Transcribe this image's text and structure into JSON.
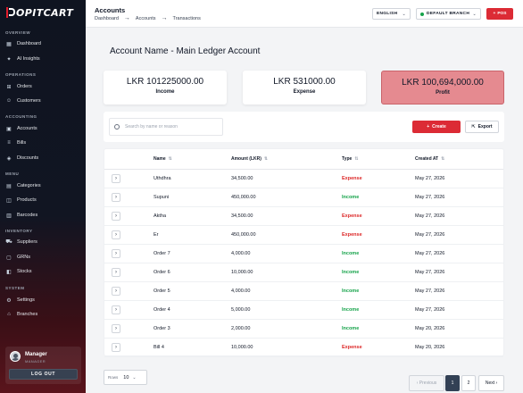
{
  "brand": {
    "logo_text": "OPITCART",
    "accent": "#dc2b35"
  },
  "sidebar": {
    "sections": [
      {
        "label": "OVERVIEW"
      },
      {
        "label": "OPERATIONS"
      },
      {
        "label": "ACCOUNTING"
      },
      {
        "label": "MENU"
      },
      {
        "label": "INVENTORY"
      },
      {
        "label": "SYSTEM"
      }
    ],
    "items": [
      {
        "label": "Dashboard",
        "icon": "grid-icon"
      },
      {
        "label": "AI Insights",
        "icon": "sparkle-icon"
      },
      {
        "label": "Orders",
        "icon": "cart-icon"
      },
      {
        "label": "Customers",
        "icon": "users-icon"
      },
      {
        "label": "Accounts",
        "icon": "wallet-icon"
      },
      {
        "label": "Bills",
        "icon": "receipt-icon"
      },
      {
        "label": "Discounts",
        "icon": "tag-icon"
      },
      {
        "label": "Categories",
        "icon": "folder-icon"
      },
      {
        "label": "Products",
        "icon": "box-icon"
      },
      {
        "label": "Barcodes",
        "icon": "barcode-icon"
      },
      {
        "label": "Suppliers",
        "icon": "truck-icon"
      },
      {
        "label": "GRNs",
        "icon": "clipboard-icon"
      },
      {
        "label": "Stocks",
        "icon": "layers-icon"
      },
      {
        "label": "Settings",
        "icon": "gear-icon"
      },
      {
        "label": "Branches",
        "icon": "branch-icon"
      }
    ],
    "user": {
      "name": "Manager",
      "role": "MANAGER",
      "logout_label": "LOG OUT"
    }
  },
  "header": {
    "title": "Accounts",
    "breadcrumbs": [
      "Dashboard",
      "Accounts",
      "Transactions"
    ],
    "language": "ENGLISH",
    "branch": "DEFAULT BRANCH",
    "pos_label": "POS"
  },
  "account": {
    "title": "Account Name - Main Ledger Account"
  },
  "stats": {
    "income": {
      "value": "LKR 101225000.00",
      "label": "Income"
    },
    "expense": {
      "value": "LKR 531000.00",
      "label": "Expense"
    },
    "profit": {
      "value": "LKR 100,694,000.00",
      "label": "Profit"
    }
  },
  "toolbar": {
    "search_placeholder": "Search by name or reason",
    "create_label": "Create",
    "export_label": "Export"
  },
  "table": {
    "columns": [
      "Name",
      "Amount (LKR)",
      "Type",
      "Created AT"
    ],
    "rows": [
      {
        "name": "Uthdhra",
        "amount": "34,500.00",
        "type": "Expense",
        "created": "May 27, 2026"
      },
      {
        "name": "Supuni",
        "amount": "450,000.00",
        "type": "Income",
        "created": "May 27, 2026"
      },
      {
        "name": "Aktha",
        "amount": "34,500.00",
        "type": "Expense",
        "created": "May 27, 2026"
      },
      {
        "name": "Er",
        "amount": "450,000.00",
        "type": "Expense",
        "created": "May 27, 2026"
      },
      {
        "name": "Order 7",
        "amount": "4,000.00",
        "type": "Income",
        "created": "May 27, 2026"
      },
      {
        "name": "Order 6",
        "amount": "10,000.00",
        "type": "Income",
        "created": "May 27, 2026"
      },
      {
        "name": "Order 5",
        "amount": "4,000.00",
        "type": "Income",
        "created": "May 27, 2026"
      },
      {
        "name": "Order 4",
        "amount": "5,000.00",
        "type": "Income",
        "created": "May 27, 2026"
      },
      {
        "name": "Order 3",
        "amount": "2,000.00",
        "type": "Income",
        "created": "May 20, 2026"
      },
      {
        "name": "Bill 4",
        "amount": "10,000.00",
        "type": "Expense",
        "created": "May 20, 2026"
      }
    ]
  },
  "pagination": {
    "rows_label": "Rows",
    "rows_value": "10",
    "prev_label": "‹ Previous",
    "pages": [
      "1",
      "2"
    ],
    "next_label": "Next ›"
  }
}
